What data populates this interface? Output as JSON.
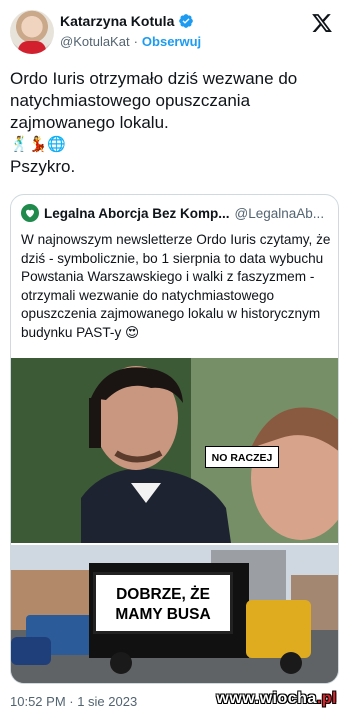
{
  "author": {
    "name": "Katarzyna Kotula",
    "handle": "@KotulaKat",
    "separator": "·",
    "follow_label": "Obserwuj",
    "verified_color": "#1d9bf0"
  },
  "brand_icon": "x-logo-icon",
  "tweet": {
    "line1": "Ordo Iuris otrzymało dziś wezwane do natychmiastowego opuszczania zajmowanego lokalu.",
    "emojis": "🕺💃🌐",
    "line2": "Pszykro."
  },
  "quoted": {
    "name": "Legalna Aborcja Bez Komp...",
    "handle": "@LegalnaAb...",
    "text": "W najnowszym newsletterze Ordo Iuris czytamy, że dziś - symbolicznie, bo 1 sierpnia to data wybuchu Powstania Warszawskiego i walki z faszyzmem - otrzymali wezwanie do natychmiastowego opuszczenia zajmowanego lokalu w historycznym budynku PAST-y 😍",
    "meme": {
      "label_top": "NO RACZEJ",
      "label_bottom_line1": "DOBRZE, ŻE",
      "label_bottom_line2": "MAMY BUSA"
    }
  },
  "footer": {
    "time": "10:52 PM · 1 sie 2023"
  },
  "watermark": {
    "main": "www.wiocha",
    "tld": ".pl"
  }
}
